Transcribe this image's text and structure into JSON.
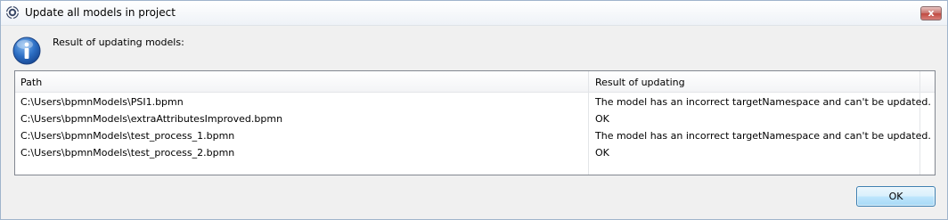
{
  "window": {
    "title": "Update all models in project",
    "close_label": "x"
  },
  "message": "Result of updating models:",
  "table": {
    "columns": [
      "Path",
      "Result of updating"
    ],
    "rows": [
      {
        "path": "C:\\Users\\bpmnModels\\PSI1.bpmn",
        "result": "The model has an incorrect targetNamespace and can't be updated."
      },
      {
        "path": "C:\\Users\\bpmnModels\\extraAttributesImproved.bpmn",
        "result": "OK"
      },
      {
        "path": "C:\\Users\\bpmnModels\\test_process_1.bpmn",
        "result": "The model has an incorrect targetNamespace and can't be updated."
      },
      {
        "path": "C:\\Users\\bpmnModels\\test_process_2.bpmn",
        "result": "OK"
      }
    ]
  },
  "buttons": {
    "ok": "OK"
  },
  "icons": {
    "app": "eclipse-gear-icon",
    "info": "information-icon",
    "close": "close-icon"
  }
}
